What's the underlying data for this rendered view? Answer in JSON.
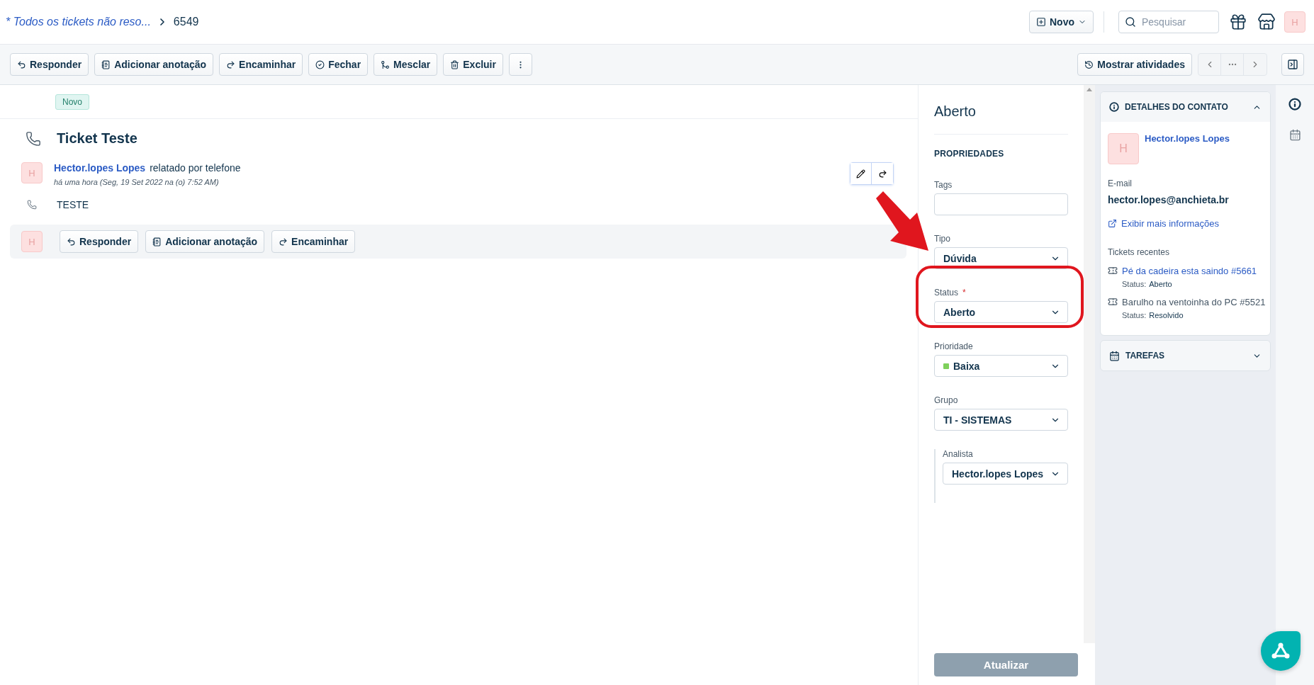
{
  "breadcrumb": {
    "link": "* Todos os tickets não reso...",
    "current": "6549"
  },
  "header": {
    "new_button": "Novo",
    "search": {
      "placeholder": "Pesquisar"
    },
    "avatar": "H"
  },
  "toolbar": {
    "actions": [
      {
        "label": "Responder"
      },
      {
        "label": "Adicionar anotação"
      },
      {
        "label": "Encaminhar"
      },
      {
        "label": "Fechar"
      },
      {
        "label": "Mesclar"
      },
      {
        "label": "Excluir"
      }
    ],
    "activity_button": "Mostrar atividades",
    "pager": {
      "disabled": true
    }
  },
  "ticket": {
    "status_badge": "Novo",
    "title": "Ticket Teste",
    "message": {
      "avatar": "H",
      "author": "Hector.lopes Lopes",
      "channel": "relatado por telefone",
      "time": "há uma hora (Seg, 19 Set 2022 na (o) 7:52 AM)",
      "body": "TESTE"
    },
    "reply_bar": {
      "avatar": "H",
      "actions": [
        {
          "label": "Responder"
        },
        {
          "label": "Adicionar anotação"
        },
        {
          "label": "Encaminhar"
        }
      ]
    }
  },
  "properties": {
    "status_title": "Aberto",
    "heading": "PROPRIEDADES",
    "fields": [
      {
        "label": "Tags",
        "kind": "text"
      },
      {
        "label": "Tipo",
        "kind": "select",
        "value": "Dúvida"
      },
      {
        "label": "Status",
        "kind": "select",
        "value": "Aberto",
        "required_mark": "*"
      },
      {
        "label": "Prioridade",
        "kind": "select",
        "value": "Baixa",
        "color": "#7ed05b"
      },
      {
        "label": "Grupo",
        "kind": "select",
        "value": "TI - SISTEMAS",
        "children": [
          {
            "label": "Analista",
            "kind": "select",
            "value": "Hector.lopes Lopes"
          }
        ]
      }
    ],
    "submit": {
      "label": "Atualizar",
      "disabled": true
    }
  },
  "contact": {
    "heading": "DETALHES DO CONTATO",
    "expanded": true,
    "avatar": "H",
    "name": "Hector.lopes Lopes",
    "email_label": "E-mail",
    "email": "hector.lopes@anchieta.br",
    "more_link": "Exibir mais informações",
    "recent_label": "Tickets recentes",
    "recent": [
      {
        "title": "Pé da cadeira esta saindo #5661",
        "status_label": "Status:",
        "status": "Aberto",
        "resolved": false
      },
      {
        "title": "Barulho na ventoinha do PC #5521",
        "status_label": "Status:",
        "status": "Resolvido",
        "resolved": true
      }
    ]
  },
  "tasks": {
    "heading": "TAREFAS",
    "expanded": false
  }
}
